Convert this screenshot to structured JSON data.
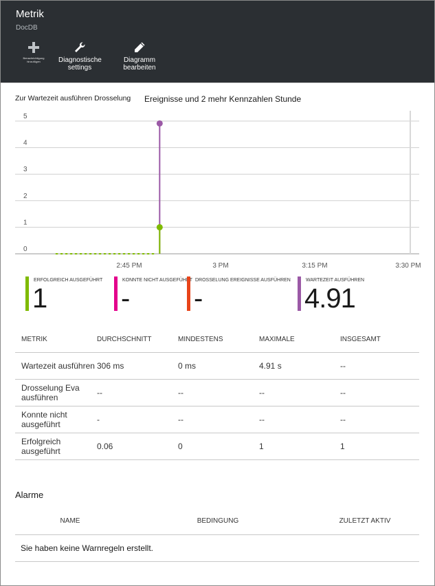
{
  "header": {
    "title": "Metrik",
    "subtitle": "DocDB"
  },
  "toolbar": {
    "add_label": "Benachrichtigung hinzufügen",
    "diag_label_1": "Diagnostische",
    "diag_label_2": "settings",
    "edit_label": "Diagramm bearbeiten"
  },
  "chart": {
    "title_part1": "Zur Wartezeit ausführen Drosselung",
    "title_part2": "Ereignisse und 2 mehr Kennzahlen Stunde"
  },
  "chart_data": {
    "type": "line",
    "x_ticks": [
      "2:45 PM",
      "3 PM",
      "3:15 PM",
      "3:30 PM"
    ],
    "y_ticks": [
      "0",
      "1",
      "2",
      "3",
      "4",
      "5"
    ],
    "ylim": [
      0,
      5
    ],
    "grid": true,
    "series": [
      {
        "name": "Wartezeit ausführen",
        "color": "#9b59a6",
        "x": [
          "2:50 PM",
          "2:50 PM"
        ],
        "values": [
          0,
          4.91
        ]
      },
      {
        "name": "Erfolgreich ausgeführt",
        "color": "#7fba00",
        "x": [
          "2:33 PM",
          "2:34 PM",
          "2:35 PM",
          "2:36 PM",
          "2:37 PM",
          "2:38 PM",
          "2:39 PM",
          "2:40 PM",
          "2:41 PM",
          "2:42 PM",
          "2:43 PM",
          "2:44 PM",
          "2:45 PM",
          "2:46 PM",
          "2:47 PM",
          "2:48 PM",
          "2:49 PM",
          "2:50 PM"
        ],
        "values": [
          0,
          0,
          0,
          0,
          0,
          0,
          0,
          0,
          0,
          0,
          0,
          0,
          0,
          0,
          0,
          0,
          0,
          1
        ]
      }
    ]
  },
  "tiles": [
    {
      "label": "Erfolgreich ausgeführt",
      "value": "1",
      "color": "#7fba00"
    },
    {
      "label": "Konnte nicht ausgeführt",
      "value": "-",
      "color": "#e3008c"
    },
    {
      "label": "Drosselung Ereignisse ausführen",
      "value": "-",
      "color": "#e8441a"
    },
    {
      "label": "Wartezeit ausführen",
      "value": "4.91",
      "color": "#9b59a6"
    }
  ],
  "metrics_table": {
    "headers": [
      "Metrik",
      "Durchschnitt",
      "Mindestens",
      "Maximale",
      "Insgesamt"
    ],
    "rows": [
      [
        "Wartezeit ausführen",
        "306 ms",
        "0 ms",
        "4.91 s",
        "--"
      ],
      [
        "Drosselung Eva ausführen",
        "--",
        "--",
        "--",
        "--"
      ],
      [
        "Konnte nicht ausgeführt",
        "-",
        "--",
        "--",
        "--"
      ],
      [
        "Erfolgreich ausgeführt",
        "0.06",
        "0",
        "1",
        "1"
      ]
    ]
  },
  "alarms": {
    "title": "Alarme",
    "headers": [
      "Name",
      "Bedingung",
      "Zuletzt aktiv"
    ],
    "empty_message": "Sie haben keine Warnregeln erstellt."
  }
}
